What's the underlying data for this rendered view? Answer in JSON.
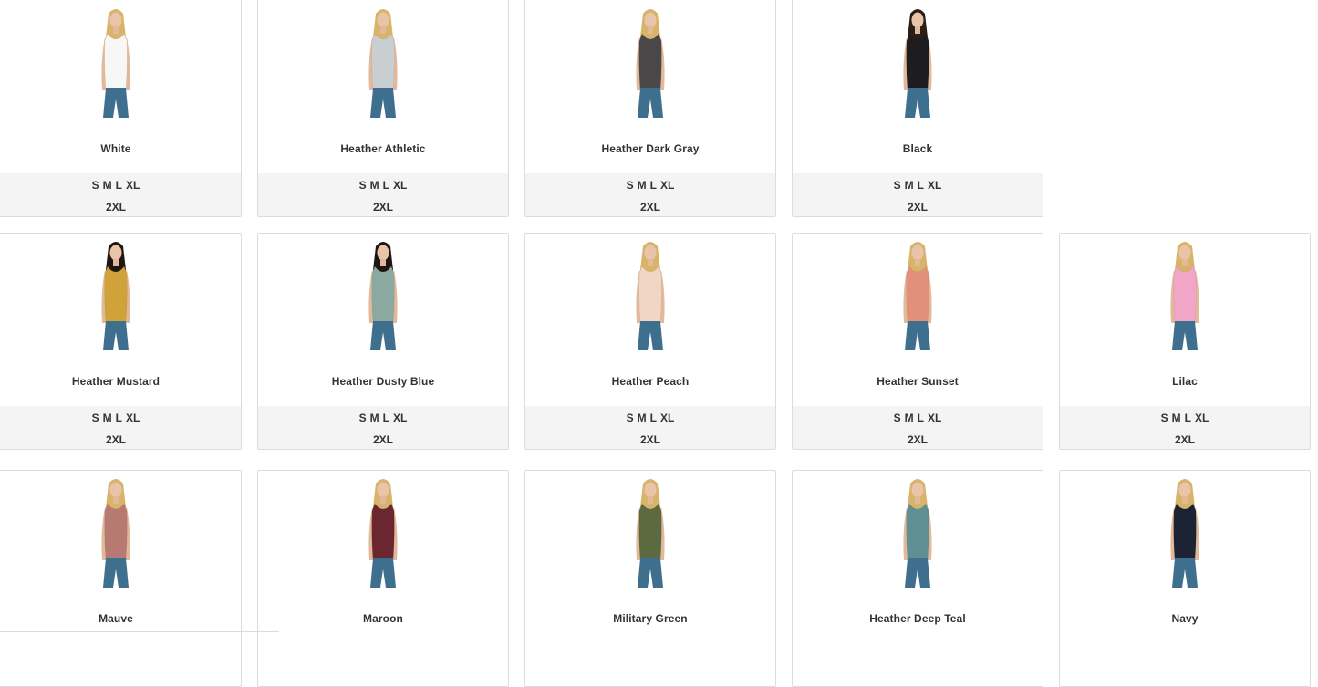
{
  "products": [
    {
      "name": "White",
      "color": "#f7f7f5",
      "hair": "#d8b36a",
      "sizes_row1": [
        "S",
        "M",
        "L",
        "XL"
      ],
      "sizes_row2": "2XL"
    },
    {
      "name": "Heather Athletic",
      "color": "#c9ced1",
      "hair": "#d8b36a",
      "sizes_row1": [
        "S",
        "M",
        "L",
        "XL"
      ],
      "sizes_row2": "2XL"
    },
    {
      "name": "Heather Dark Gray",
      "color": "#4a4748",
      "hair": "#d8b36a",
      "sizes_row1": [
        "S",
        "M",
        "L",
        "XL"
      ],
      "sizes_row2": "2XL"
    },
    {
      "name": "Black",
      "color": "#1d1d1f",
      "hair": "#2a1e18",
      "sizes_row1": [
        "S",
        "M",
        "L",
        "XL"
      ],
      "sizes_row2": "2XL"
    },
    {
      "name": "Heather Mustard",
      "color": "#d2a23a",
      "hair": "#1f1611",
      "sizes_row1": [
        "S",
        "M",
        "L",
        "XL"
      ],
      "sizes_row2": "2XL"
    },
    {
      "name": "Heather Dusty Blue",
      "color": "#8aa9a0",
      "hair": "#1f1611",
      "sizes_row1": [
        "S",
        "M",
        "L",
        "XL"
      ],
      "sizes_row2": "2XL"
    },
    {
      "name": "Heather Peach",
      "color": "#f1d6c6",
      "hair": "#d8b36a",
      "sizes_row1": [
        "S",
        "M",
        "L",
        "XL"
      ],
      "sizes_row2": "2XL"
    },
    {
      "name": "Heather Sunset",
      "color": "#e2907a",
      "hair": "#d8b36a",
      "sizes_row1": [
        "S",
        "M",
        "L",
        "XL"
      ],
      "sizes_row2": "2XL"
    },
    {
      "name": "Lilac",
      "color": "#f2a6c7",
      "hair": "#d8b36a",
      "sizes_row1": [
        "S",
        "M",
        "L",
        "XL"
      ],
      "sizes_row2": "2XL"
    },
    {
      "name": "Mauve",
      "color": "#b77a72",
      "hair": "#d8b36a",
      "sizes_row1": [],
      "sizes_row2": ""
    },
    {
      "name": "Maroon",
      "color": "#6a2730",
      "hair": "#d8b36a",
      "sizes_row1": [],
      "sizes_row2": ""
    },
    {
      "name": "Military Green",
      "color": "#5b6b3f",
      "hair": "#d8b36a",
      "sizes_row1": [],
      "sizes_row2": ""
    },
    {
      "name": "Heather Deep Teal",
      "color": "#5f8e93",
      "hair": "#d8b36a",
      "sizes_row1": [],
      "sizes_row2": ""
    },
    {
      "name": "Navy",
      "color": "#1b2335",
      "hair": "#d8b36a",
      "sizes_row1": [],
      "sizes_row2": ""
    }
  ]
}
